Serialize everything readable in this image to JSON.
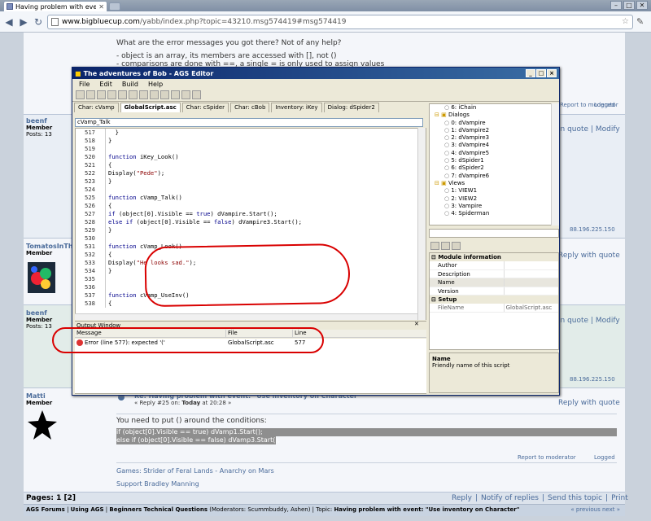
{
  "browser": {
    "tab_title": "Having problem with event:",
    "url_domain": "www.bigbluecup.com",
    "url_path": "/yabb/index.php?topic=43210.msg574419#msg574419"
  },
  "top_post": {
    "line1": "What are the error messages you got there? Not of any help?",
    "line2": "- object is an array, its members are accessed with [], not ()",
    "line3": "- comparisons are done with ==, a single = is only used to assign values"
  },
  "actions": {
    "report": "Report to moderator",
    "logged": "Logged",
    "quote": "Reply with quote",
    "in_quote": "in quote",
    "modify": "Modify",
    "ip": "88.196.225.150"
  },
  "posts": [
    {
      "name": "beenf",
      "rank": "Member",
      "count": "Posts: 13"
    },
    {
      "name": "TomatosInTh",
      "rank": "Member",
      "count": ""
    },
    {
      "name": "beenf",
      "rank": "Member",
      "count": "Posts: 13"
    },
    {
      "name": "Matti",
      "rank": "Member",
      "count": ""
    }
  ],
  "matti_post": {
    "subject": "Re: Having problem with event: \"Use inventory on Character\"",
    "meta_prefix": "« Reply #25 on: ",
    "meta_day": "Today",
    "meta_time": " at 20:28 »",
    "text": "You need to put () around the conditions:",
    "code1": "if (object[0].Visible == true) dVamp1.Start();",
    "code2": "else if (object[0].Visible == false) dVamp3.Start();",
    "sig1": "Games:  Strider of Feral Lands - Anarchy on Mars",
    "sig2": "Support Bradley Manning"
  },
  "pages": {
    "label": "Pages: 1 [2]"
  },
  "bottom_links": [
    "Reply",
    "Notify of replies",
    "Send this topic",
    "Print"
  ],
  "breadcrumb": {
    "forums": "AGS Forums",
    "using": "Using AGS",
    "board": "Beginners Technical Questions",
    "mods": " (Moderators: Scummbuddy, Ashen)",
    "topic_label": "Topic: ",
    "topic": "Having problem with event: \"Use inventory on Character\"",
    "nav": "« previous next »"
  },
  "editor": {
    "title": "The adventures of Bob - AGS Editor",
    "menu": [
      "File",
      "Edit",
      "Build",
      "Help"
    ],
    "tabs": [
      "Char: cVamp",
      "GlobalScript.asc",
      "Char: cSpider",
      "Char: cBob",
      "Inventory: iKey",
      "Dialog: dSpider2"
    ],
    "combo": "cVamp_Talk",
    "code_lines": [
      {
        "n": "517",
        "t": "  }"
      },
      {
        "n": "518",
        "t": "}"
      },
      {
        "n": "519",
        "t": ""
      },
      {
        "n": "520",
        "t": "function iKey_Look()"
      },
      {
        "n": "521",
        "t": "{"
      },
      {
        "n": "522",
        "t": "Display(\"Pede\");"
      },
      {
        "n": "523",
        "t": "}"
      },
      {
        "n": "524",
        "t": ""
      },
      {
        "n": "525",
        "t": "function cVamp_Talk()"
      },
      {
        "n": "526",
        "t": "{"
      },
      {
        "n": "527",
        "t": "if (object[0].Visible == true) dVampire.Start();"
      },
      {
        "n": "528",
        "t": "else if (object[0].Visible == false) dVampire3.Start();"
      },
      {
        "n": "529",
        "t": "}"
      },
      {
        "n": "530",
        "t": ""
      },
      {
        "n": "531",
        "t": "function cVamp_Look()"
      },
      {
        "n": "532",
        "t": "{"
      },
      {
        "n": "533",
        "t": "Display(\"He looks sad.\");"
      },
      {
        "n": "534",
        "t": "}"
      },
      {
        "n": "535",
        "t": ""
      },
      {
        "n": "536",
        "t": ""
      },
      {
        "n": "537",
        "t": "function cVamp_UseInv()"
      },
      {
        "n": "538",
        "t": "{"
      }
    ],
    "output_title": "Output Window",
    "output_cols": [
      "Message",
      "File",
      "Line"
    ],
    "output_row": {
      "message": "Error (line 577): expected '('",
      "file": "GlobalScript.asc",
      "line": "577"
    },
    "tree": [
      "6: iChain",
      "Dialogs",
      "0: dVampire",
      "1: dVampire2",
      "2: dVampire3",
      "3: dVampire4",
      "4: dVampire5",
      "5: dSpider1",
      "6: dSpider2",
      "7: dVampire6",
      "Views",
      "1: VIEW1",
      "2: VIEW2",
      "3: Vampire",
      "4: Spiderman"
    ],
    "props_sections": [
      "Module information",
      "Setup"
    ],
    "props_rows": [
      {
        "k": "Author",
        "v": ""
      },
      {
        "k": "Description",
        "v": ""
      },
      {
        "k": "Name",
        "v": ""
      },
      {
        "k": "Version",
        "v": ""
      }
    ],
    "props_setup": {
      "k": "FileName",
      "v": "GlobalScript.asc"
    },
    "desc_title": "Name",
    "desc_text": "Friendly name of this script"
  },
  "colors": {
    "link": "#4a6b9a",
    "annotation": "#d90000",
    "title_bar": "#0a246a"
  }
}
